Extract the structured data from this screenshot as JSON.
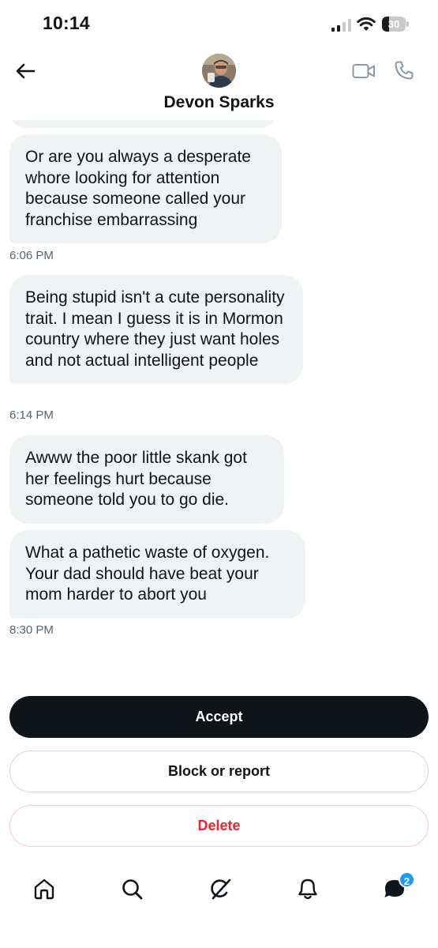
{
  "status_bar": {
    "time": "10:14",
    "battery_level": "30",
    "battery_fraction": 0.3
  },
  "header": {
    "contact_name": "Devon Sparks"
  },
  "messages": [
    {
      "text": "Or are you always a desperate whore looking for attention because someone called your franchise embarrassing",
      "time": "6:06 PM"
    },
    {
      "text": "Being stupid isn't a cute personality trait. I mean I guess it is in Mormon country where they just want holes and not actual intelligent people",
      "time": "6:14 PM"
    },
    {
      "text": "Awww the poor little skank got her feelings hurt because someone told you to go die.",
      "time": ""
    },
    {
      "text": "What a pathetic waste of oxygen. Your dad should have beat your mom harder to abort you",
      "time": "8:30 PM"
    }
  ],
  "actions": {
    "accept": "Accept",
    "block": "Block or report",
    "delete": "Delete"
  },
  "tab_bar": {
    "items": [
      "home-icon",
      "search-icon",
      "grok-icon",
      "notifications-icon",
      "messages-icon"
    ],
    "messages_badge": "2"
  },
  "colors": {
    "bubble": "#eff3f4",
    "accent": "#1d9bf0",
    "danger": "#f4212e",
    "primary_button": "#0f1419"
  }
}
